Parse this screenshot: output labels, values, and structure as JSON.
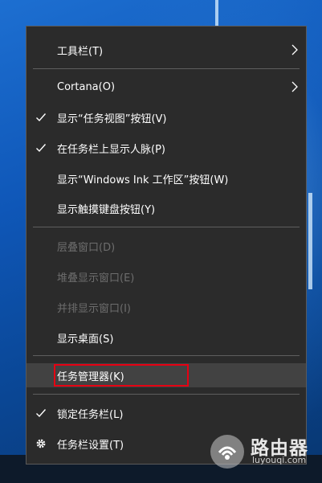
{
  "menu": {
    "items": [
      {
        "label": "工具栏(T)",
        "disabled": false
      },
      {
        "label": "Cortana(O)",
        "disabled": false
      },
      {
        "label": "显示“任务视图”按钮(V)",
        "disabled": false
      },
      {
        "label": "在任务栏上显示人脉(P)",
        "disabled": false
      },
      {
        "label": "显示“Windows Ink 工作区”按钮(W)",
        "disabled": false
      },
      {
        "label": "显示触摸键盘按钮(Y)",
        "disabled": false
      },
      {
        "label": "层叠窗口(D)",
        "disabled": true
      },
      {
        "label": "堆叠显示窗口(E)",
        "disabled": true
      },
      {
        "label": "并排显示窗口(I)",
        "disabled": true
      },
      {
        "label": "显示桌面(S)",
        "disabled": false
      },
      {
        "label": "任务管理器(K)",
        "disabled": false
      },
      {
        "label": "锁定任务栏(L)",
        "disabled": false
      },
      {
        "label": "任务栏设置(T)",
        "disabled": false
      }
    ]
  },
  "watermark": {
    "brand": "路由器",
    "domain": "luyouqi.com"
  },
  "colors": {
    "menu_bg": "#2b2b2b",
    "highlight_border": "#e60012",
    "disabled_text": "#6d6d6d"
  }
}
